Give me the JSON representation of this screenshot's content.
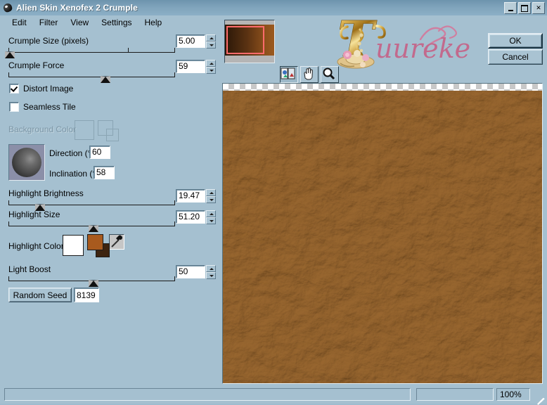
{
  "window": {
    "title": "Alien Skin Xenofex 2 Crumple",
    "icon": "alien-head-icon",
    "buttons": {
      "minimize": "_",
      "maximize": "▫",
      "close": "✕"
    }
  },
  "menubar": {
    "items": [
      {
        "label": "Edit"
      },
      {
        "label": "Filter"
      },
      {
        "label": "View"
      },
      {
        "label": "Settings"
      },
      {
        "label": "Help"
      }
    ]
  },
  "controls": {
    "crumple_size": {
      "label": "Crumple Size (pixels)",
      "value": "5.00",
      "thumb_pct": 1,
      "tick_pct": 72
    },
    "crumple_force": {
      "label": "Crumple Force",
      "value": "59",
      "thumb_pct": 58
    },
    "distort_image": {
      "label": "Distort Image",
      "checked": true
    },
    "seamless_tile": {
      "label": "Seamless Tile",
      "checked": false
    },
    "background_color": {
      "label": "Background Color",
      "enabled": false
    },
    "direction": {
      "label": "Direction (°)",
      "value": "60"
    },
    "inclination": {
      "label": "Inclination (°)",
      "value": "58"
    },
    "highlight_brightness": {
      "label": "Highlight Brightness",
      "value": "19.47",
      "thumb_pct": 19
    },
    "highlight_size": {
      "label": "Highlight Size",
      "value": "51.20",
      "thumb_pct": 51
    },
    "highlight_color": {
      "label": "Highlight Color",
      "primary_hex": "#ffffff",
      "secondary_hex": "#a85a1e",
      "tertiary_hex": "#3d2410",
      "picker_icon": "eyedropper-icon"
    },
    "light_boost": {
      "label": "Light Boost",
      "value": "50",
      "thumb_pct": 51
    },
    "random_seed": {
      "label": "Random Seed",
      "value": "8139"
    },
    "light_sphere": {
      "name": "light-direction-sphere"
    }
  },
  "toolbar": {
    "tools": [
      {
        "name": "compare-preview-tool",
        "icon": "compare-icon",
        "active": true
      },
      {
        "name": "pan-tool",
        "icon": "hand-icon",
        "active": false
      },
      {
        "name": "zoom-tool",
        "icon": "magnifier-icon",
        "active": false
      }
    ]
  },
  "navigator": {
    "name": "navigator-thumbnail"
  },
  "watermark": {
    "initial": "T",
    "text": "uureke"
  },
  "actions": {
    "ok": "OK",
    "cancel": "Cancel"
  },
  "preview": {
    "name": "image-preview"
  },
  "statusbar": {
    "message": "",
    "zoom": "100%"
  },
  "colors": {
    "dialog_bg": "#a5c0d0",
    "title_bar": "#7fa3bb",
    "selection_red": "#ff6b6b",
    "accent_brown": "#7a4a1e",
    "watermark_pink": "#c26a8d"
  }
}
